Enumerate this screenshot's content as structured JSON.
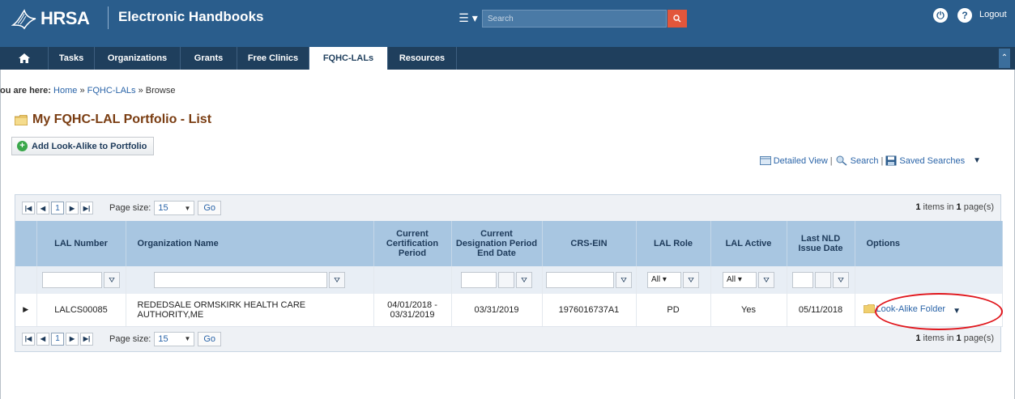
{
  "header": {
    "logo_text": "HRSA",
    "app_title": "Electronic Handbooks",
    "search_placeholder": "Search",
    "logout_label": "Logout"
  },
  "nav": {
    "items": [
      {
        "label": "Tasks"
      },
      {
        "label": "Organizations"
      },
      {
        "label": "Grants"
      },
      {
        "label": "Free Clinics"
      },
      {
        "label": "FQHC-LALs",
        "active": true
      },
      {
        "label": "Resources"
      }
    ]
  },
  "breadcrumb": {
    "prefix": "ou are here:",
    "home": "Home",
    "sep": "»",
    "section": "FQHC-LALs",
    "current": "Browse"
  },
  "page": {
    "title": "My FQHC-LAL Portfolio - List",
    "add_button": "Add Look-Alike to Portfolio"
  },
  "view_links": {
    "detailed_view": "Detailed View",
    "search": "Search",
    "saved_searches": "Saved Searches"
  },
  "pager": {
    "page_num": "1",
    "page_size_label": "Page size:",
    "page_size": "15",
    "go_label": "Go",
    "items_count": "1",
    "items_text": "items in",
    "pages_count": "1",
    "pages_text": "page(s)"
  },
  "table": {
    "columns": [
      "LAL Number",
      "Organization Name",
      "Current Certification Period",
      "Current Designation Period End Date",
      "CRS-EIN",
      "LAL Role",
      "LAL Active",
      "Last NLD Issue Date",
      "Options"
    ],
    "filters": {
      "role_value": "All",
      "active_value": "All"
    },
    "rows": [
      {
        "lal_number": "LALCS00085",
        "org_name": "REDEDSALE ORMSKIRK HEALTH CARE AUTHORITY,ME",
        "cert_period": "04/01/2018 - 03/31/2019",
        "designation_end": "03/31/2019",
        "crs_ein": "1976016737A1",
        "lal_role": "PD",
        "lal_active": "Yes",
        "last_nld": "05/11/2018",
        "option_link": "Look-Alike Folder"
      }
    ]
  },
  "colors": {
    "header_blue": "#2a5d8c",
    "nav_dark": "#1f3f5d",
    "column_header": "#a8c6e1",
    "title_brown": "#7a3d12",
    "highlight_red": "#e0161c"
  }
}
